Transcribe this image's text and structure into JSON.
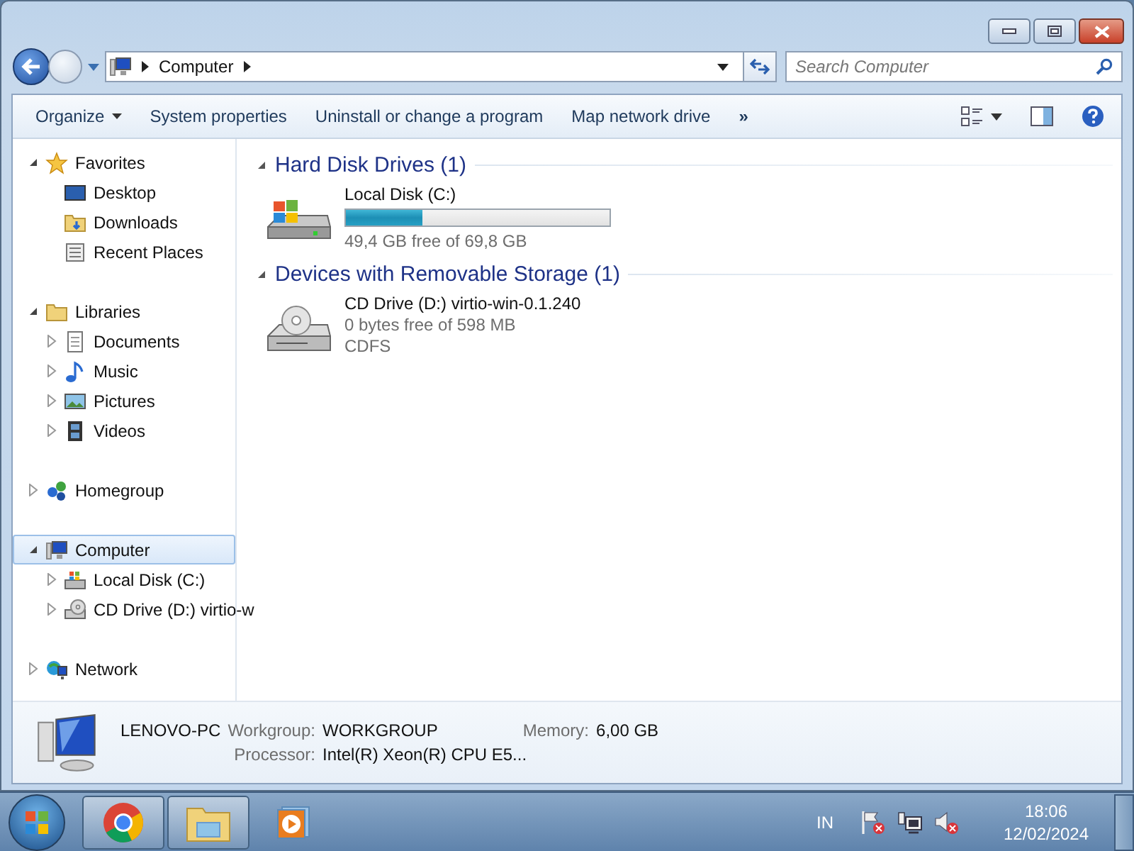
{
  "address": {
    "crumbs": [
      "Computer"
    ]
  },
  "search": {
    "placeholder": "Search Computer"
  },
  "toolbar": {
    "items": [
      {
        "label": "Organize",
        "dropdown": true
      },
      {
        "label": "System properties",
        "dropdown": false
      },
      {
        "label": "Uninstall or change a program",
        "dropdown": false
      },
      {
        "label": "Map network drive",
        "dropdown": false
      }
    ],
    "overflow": "»"
  },
  "nav": {
    "items": [
      {
        "kind": "favorites",
        "label": "Favorites",
        "expanded": true,
        "selected": false,
        "children": [
          {
            "kind": "desktop",
            "label": "Desktop",
            "selected": false
          },
          {
            "kind": "downloads",
            "label": "Downloads",
            "selected": false
          },
          {
            "kind": "recent",
            "label": "Recent Places",
            "selected": false
          }
        ]
      },
      {
        "kind": "libraries",
        "label": "Libraries",
        "expanded": true,
        "selected": false,
        "children": [
          {
            "kind": "documents",
            "label": "Documents",
            "expanded": false,
            "selected": false
          },
          {
            "kind": "music",
            "label": "Music",
            "expanded": false,
            "selected": false
          },
          {
            "kind": "pictures",
            "label": "Pictures",
            "expanded": false,
            "selected": false
          },
          {
            "kind": "videos",
            "label": "Videos",
            "expanded": false,
            "selected": false
          }
        ]
      },
      {
        "kind": "homegroup",
        "label": "Homegroup",
        "expanded": false,
        "selected": false
      },
      {
        "kind": "computer",
        "label": "Computer",
        "expanded": true,
        "selected": true,
        "children": [
          {
            "kind": "hdd",
            "label": "Local Disk (C:)",
            "expanded": false,
            "selected": false
          },
          {
            "kind": "cd",
            "label": "CD Drive (D:) virtio-w",
            "expanded": false,
            "selected": false
          }
        ]
      },
      {
        "kind": "network",
        "label": "Network",
        "expanded": false,
        "selected": false
      }
    ]
  },
  "groups": [
    {
      "title": "Hard Disk Drives (1)",
      "expanded": true,
      "drives": [
        {
          "kind": "hdd",
          "name": "Local Disk (C:)",
          "level": 0.29,
          "lines": [
            "49,4 GB free of 69,8 GB"
          ]
        }
      ]
    },
    {
      "title": "Devices with Removable Storage (1)",
      "expanded": true,
      "drives": [
        {
          "kind": "cd",
          "name": "CD Drive (D:) virtio-win-0.1.240",
          "lines": [
            "0 bytes free of 598 MB",
            "CDFS"
          ]
        }
      ]
    }
  ],
  "details": {
    "name": "LENOVO-PC",
    "fields": [
      {
        "label": "Workgroup:",
        "value": "WORKGROUP"
      },
      {
        "label": "Memory:",
        "value": "6,00 GB"
      },
      {
        "label": "Processor:",
        "value": "Intel(R) Xeon(R) CPU E5..."
      }
    ]
  },
  "taskbar": {
    "apps": [
      {
        "kind": "chrome",
        "running": true
      },
      {
        "kind": "explorer",
        "running": true
      },
      {
        "kind": "media",
        "running": false
      }
    ]
  },
  "tray": {
    "language": "IN",
    "time": "18:06",
    "date": "12/02/2024"
  }
}
